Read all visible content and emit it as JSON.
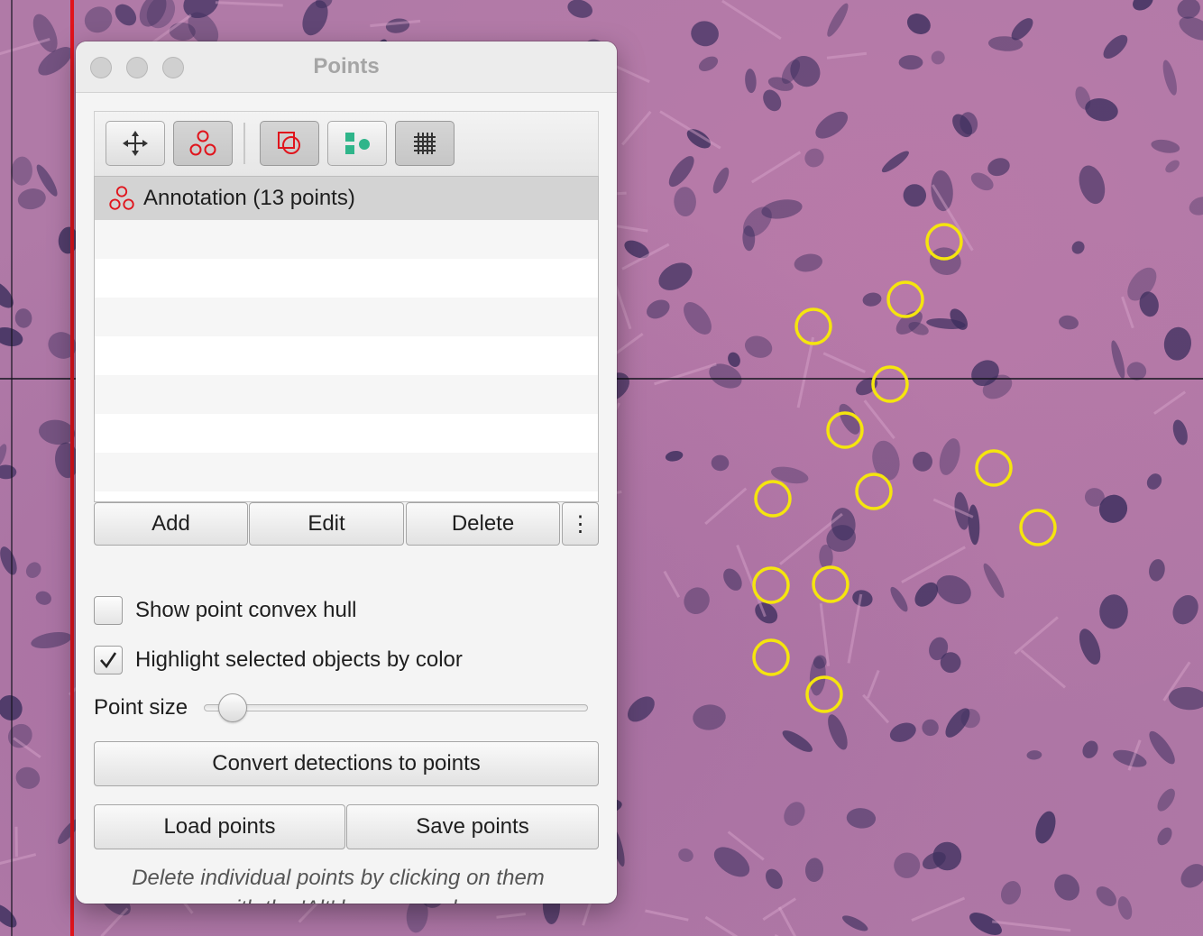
{
  "dialog": {
    "title": "Points",
    "toolbar": {
      "tools": [
        {
          "name": "move-tool",
          "icon": "move-arrows-icon",
          "active": false
        },
        {
          "name": "points-tool",
          "icon": "points-icon",
          "active": true
        },
        {
          "name": "selection-mode",
          "icon": "selection-mode-icon",
          "active": true
        },
        {
          "name": "show-detections",
          "icon": "detections-icon",
          "active": false
        },
        {
          "name": "show-grid",
          "icon": "grid-icon",
          "active": true
        }
      ]
    },
    "list": {
      "items": [
        {
          "label": "Annotation (13 points)",
          "icon": "points-icon",
          "selected": true
        }
      ]
    },
    "buttons": {
      "add": "Add",
      "edit": "Edit",
      "delete": "Delete",
      "more": "⋮"
    },
    "options": {
      "show_hull": {
        "label": "Show point convex hull",
        "checked": false
      },
      "highlight": {
        "label": "Highlight selected objects by color",
        "checked": true
      }
    },
    "point_size": {
      "label": "Point size",
      "value_fraction": 0.04
    },
    "convert_button": "Convert detections to points",
    "load_button": "Load points",
    "save_button": "Save points",
    "note_line1": "Delete individual points by clicking on them",
    "note_line2": "with the 'Alt' key pressed"
  },
  "colors": {
    "point_marker": "#f5e50e",
    "annotation_icon": "#e0141c",
    "tissue": "#b07aa7",
    "nucleus": "#3d2f5e"
  },
  "overlay": {
    "point_count": 13
  }
}
